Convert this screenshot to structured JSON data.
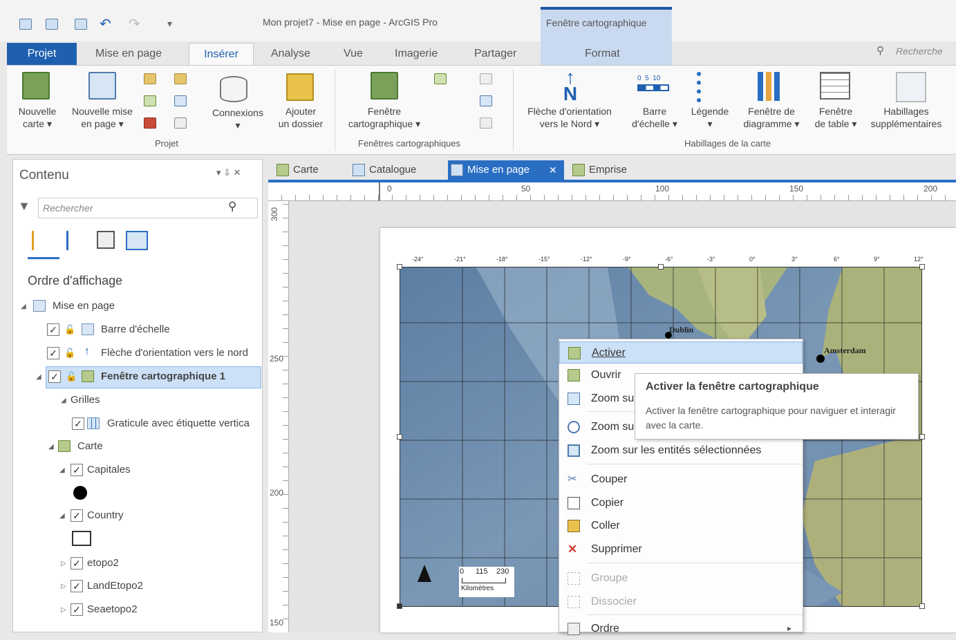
{
  "window": {
    "title": "Mon projet7 - Mise en page - ArcGIS Pro",
    "context_tab_group": "Fenêtre cartographique"
  },
  "ribbon_tabs": [
    "Projet",
    "Mise en page",
    "Insérer",
    "Analyse",
    "Vue",
    "Imagerie",
    "Partager",
    "Format"
  ],
  "search_top": "Recherche",
  "ribbon": {
    "projet_group": {
      "label": "Projet",
      "buttons": [
        "Nouvelle\ncarte ▾",
        "Nouvelle mise\nen page ▾",
        "Connexions\n▾",
        "Ajouter\nun dossier"
      ]
    },
    "fenetres_group": {
      "label": "Fenêtres cartographiques",
      "buttons": [
        "Fenêtre\ncartographique ▾"
      ]
    },
    "habillages_group": {
      "label": "Habillages de la carte",
      "buttons": [
        "Flèche d'orientation\nvers le Nord ▾",
        "Barre\nd'échelle ▾",
        "Légende\n▾",
        "Fenêtre de\ndiagramme ▾",
        "Fenêtre\nde table ▾",
        "Habillages\nsupplémentaires"
      ],
      "scale_icon_text": "0  5  10"
    }
  },
  "contents": {
    "title": "Contenu",
    "search_placeholder": "Rechercher",
    "order_title": "Ordre d'affichage",
    "items": [
      "Mise en page",
      "Barre d'échelle",
      "Flèche d'orientation vers le nord",
      "Fenêtre cartographique 1",
      "Grilles",
      "Graticule avec étiquette vertica",
      "Carte",
      "Capitales",
      "Country",
      "etopo2",
      "LandEtopo2",
      "Seaetopo2"
    ],
    "pane_controls": "▾ ⇩ ✕"
  },
  "view_tabs": [
    "Carte",
    "Catalogue",
    "Mise en page",
    "Emprise"
  ],
  "ruler": {
    "top": [
      "0",
      "50",
      "100",
      "150",
      "200"
    ],
    "left": [
      "300",
      "250",
      "200",
      "150"
    ]
  },
  "map": {
    "cities": [
      "Dublin",
      "Amsterdam"
    ],
    "scalebar": {
      "labels": [
        "0",
        "115",
        "230"
      ],
      "unit": "Kilomètres"
    },
    "graticule_top": [
      "-24°",
      "-21°",
      "-18°",
      "-15°",
      "-12°",
      "-9°",
      "-6°",
      "-3°",
      "0°",
      "3°",
      "6°",
      "9°",
      "12°"
    ],
    "colors": {
      "ocean": "#6f8fb0",
      "land": "#a7b47d"
    }
  },
  "context_menu": {
    "items": [
      {
        "label": "Activer",
        "icon": "activate-icon",
        "enabled": true,
        "highlighted": true
      },
      {
        "label": "Ouvrir",
        "icon": "open-icon",
        "enabled": true
      },
      {
        "label": "Zoom su",
        "icon": "zoom-icon",
        "enabled": true
      },
      {
        "label": "Zoom su",
        "icon": "zoom-extent-icon",
        "enabled": true
      },
      {
        "label": "Zoom sur les entités sélectionnées",
        "icon": "zoom-selected-icon",
        "enabled": true
      },
      {
        "label": "Couper",
        "icon": "cut-icon",
        "enabled": true
      },
      {
        "label": "Copier",
        "icon": "copy-icon",
        "enabled": true
      },
      {
        "label": "Coller",
        "icon": "paste-icon",
        "enabled": true
      },
      {
        "label": "Supprimer",
        "icon": "delete-icon",
        "enabled": true
      },
      {
        "label": "Groupe",
        "icon": "group-icon",
        "enabled": false
      },
      {
        "label": "Dissocier",
        "icon": "ungroup-icon",
        "enabled": false
      },
      {
        "label": "Ordre",
        "icon": "order-icon",
        "enabled": true
      }
    ],
    "submenu_arrow": "▸"
  },
  "tooltip": {
    "title": "Activer la fenêtre cartographique",
    "body": "Activer la fenêtre cartographique pour naviguer et interagir avec la carte."
  }
}
